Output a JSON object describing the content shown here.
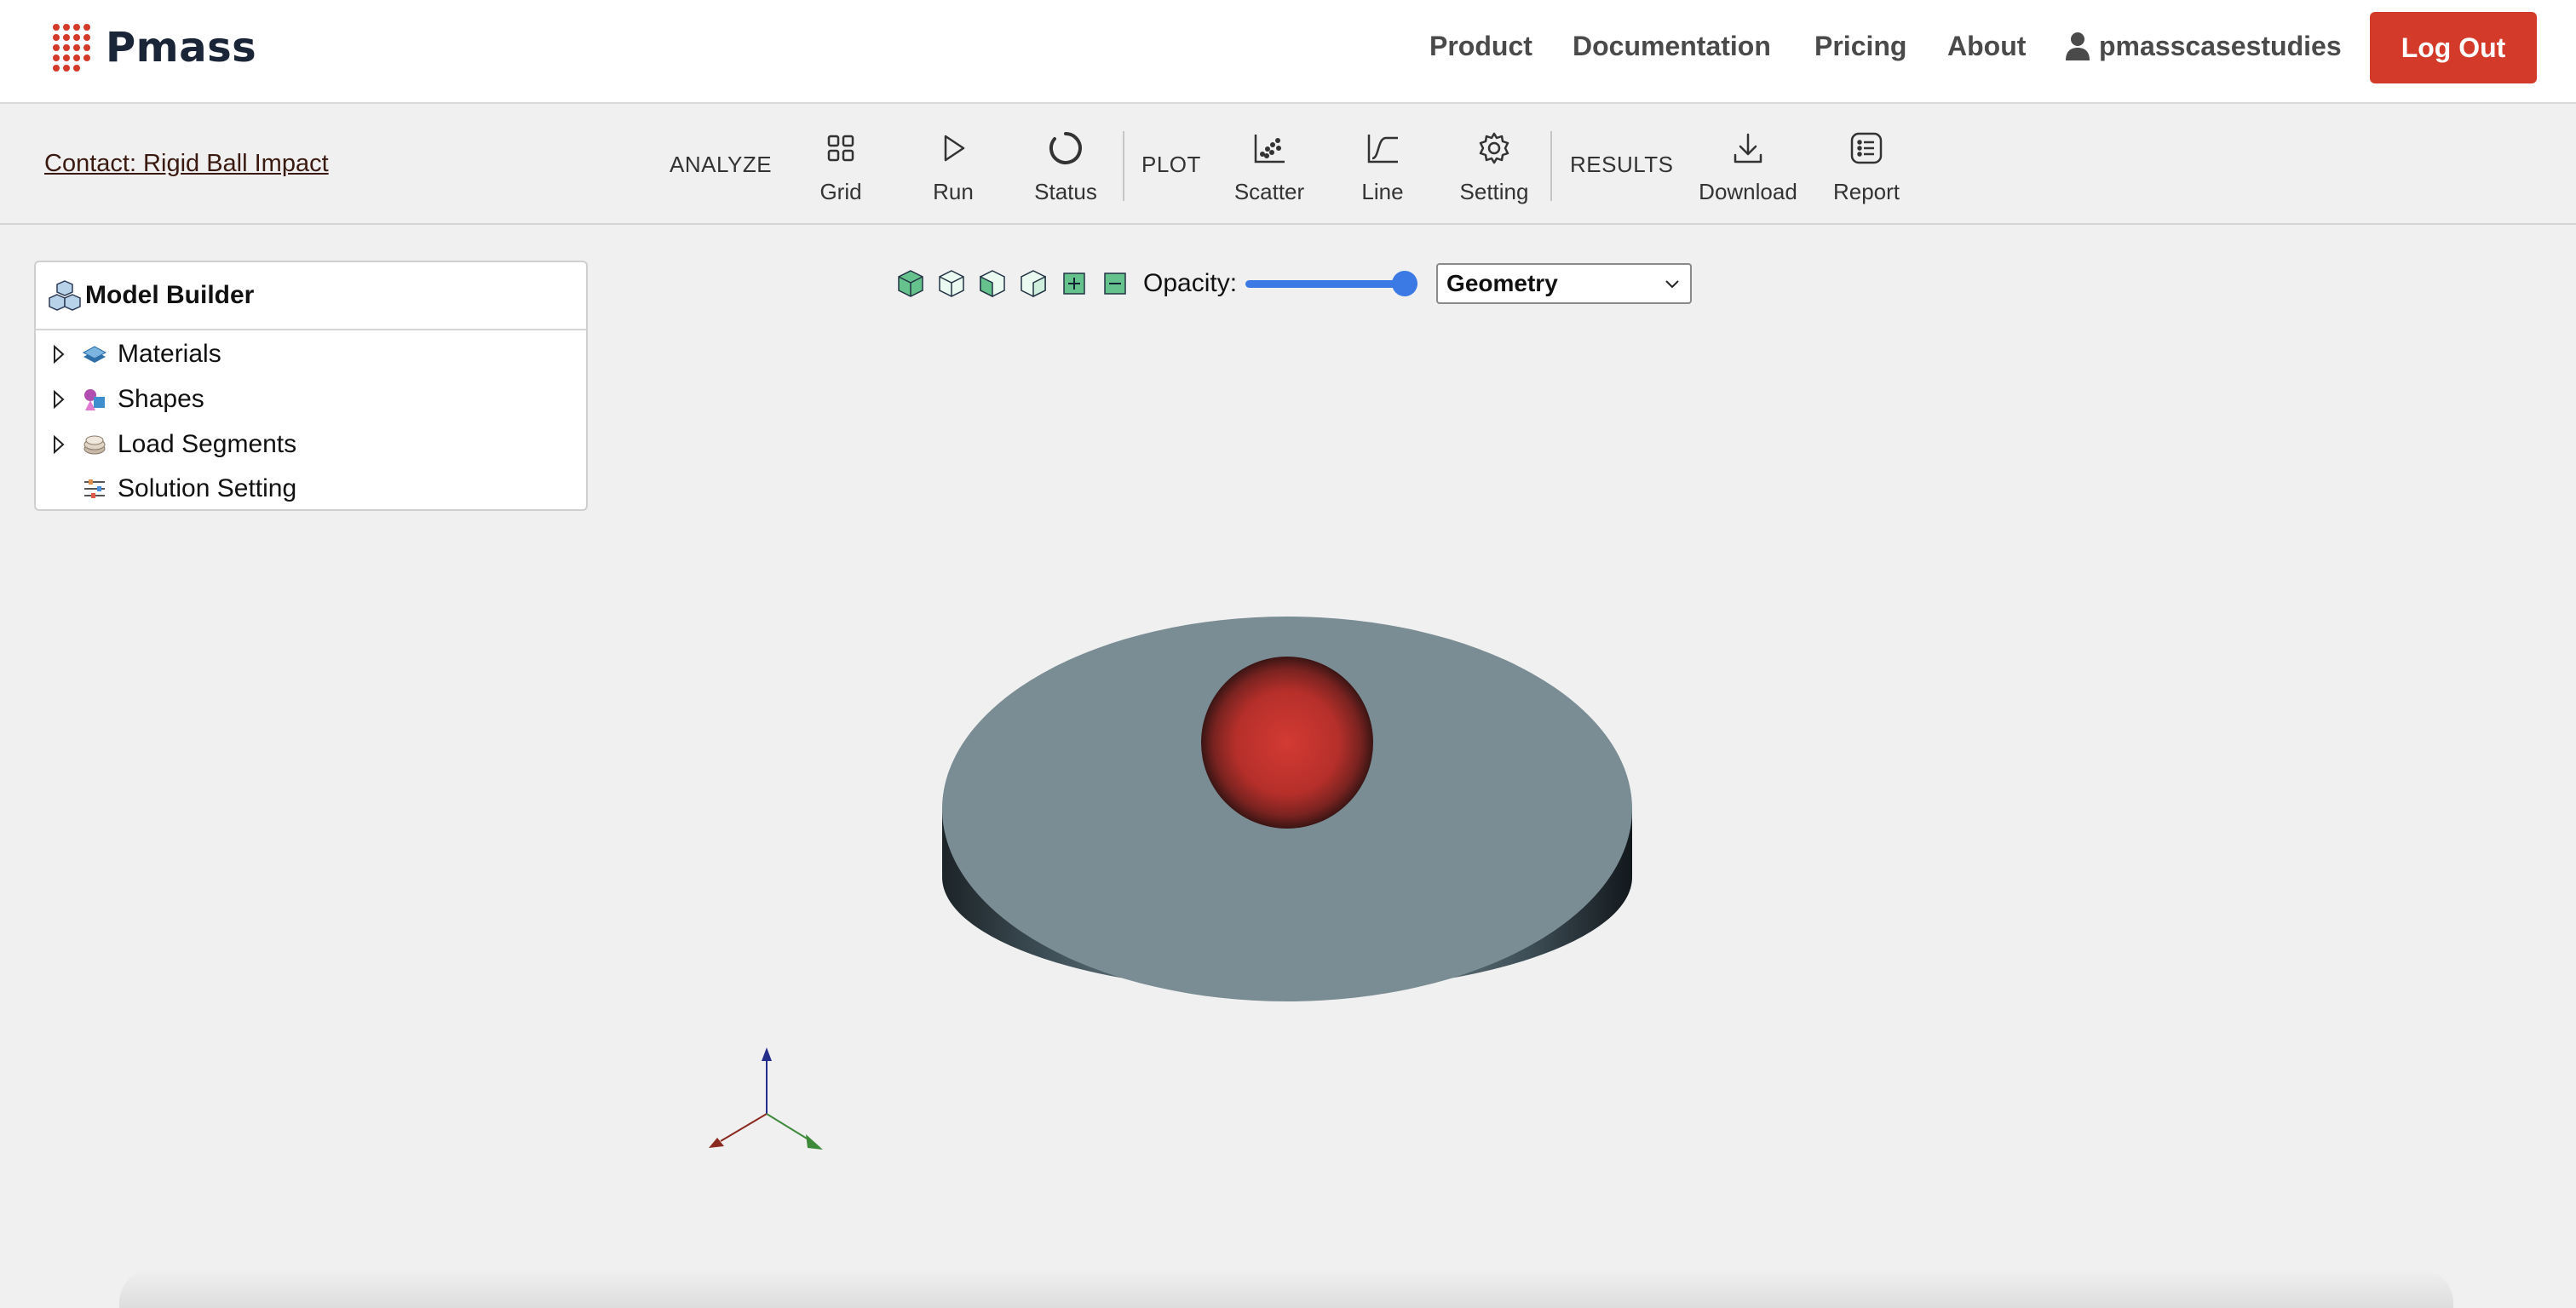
{
  "brand": {
    "name": "Pmass",
    "accent": "#d43a2a"
  },
  "nav": {
    "product": "Product",
    "documentation": "Documentation",
    "pricing": "Pricing",
    "about": "About",
    "username": "pmasscasestudies",
    "logout": "Log Out"
  },
  "toolbar": {
    "case_title": "Contact: Rigid Ball Impact",
    "analyze_label": "ANALYZE",
    "plot_label": "PLOT",
    "results_label": "RESULTS",
    "buttons": {
      "grid": "Grid",
      "run": "Run",
      "status": "Status",
      "scatter": "Scatter",
      "line": "Line",
      "setting": "Setting",
      "download": "Download",
      "report": "Report"
    }
  },
  "model_builder": {
    "title": "Model Builder",
    "items": [
      {
        "label": "Materials",
        "icon": "materials-icon",
        "expandable": true
      },
      {
        "label": "Shapes",
        "icon": "shapes-icon",
        "expandable": true
      },
      {
        "label": "Load Segments",
        "icon": "load-segments-icon",
        "expandable": true
      },
      {
        "label": "Solution Setting",
        "icon": "solution-setting-icon",
        "expandable": false
      }
    ]
  },
  "viewer": {
    "opacity_label": "Opacity:",
    "opacity_value": 1.0,
    "display_mode": "Geometry",
    "view_icons": [
      "view-iso-solid-icon",
      "view-iso-wire-icon",
      "view-front-icon",
      "view-side-icon",
      "zoom-in-icon",
      "zoom-out-icon"
    ],
    "colors": {
      "plate": "#7a8c94",
      "ball": "#c63a33",
      "slider": "#3b7ae4",
      "x_axis": "#8a2a20",
      "y_axis": "#3e8a3a",
      "z_axis": "#232e8a"
    }
  }
}
